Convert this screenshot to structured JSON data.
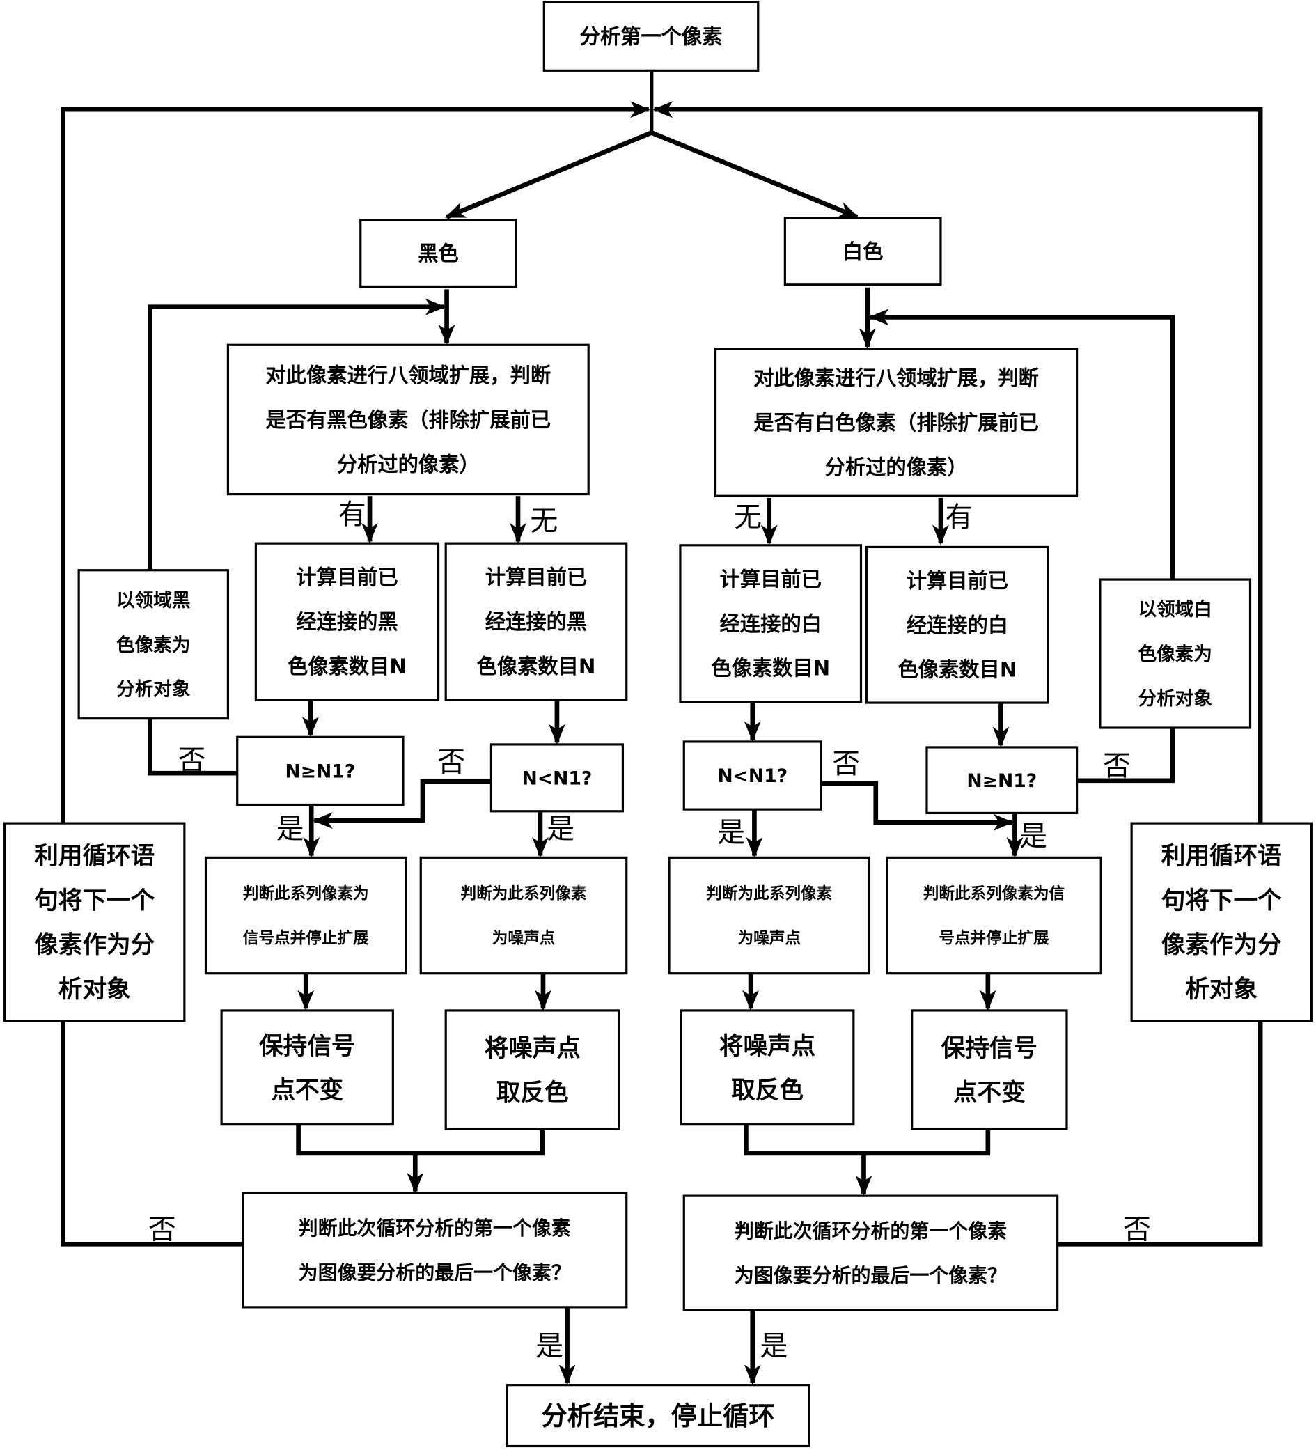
{
  "diagram": {
    "type": "flowchart",
    "nodes": {
      "start": {
        "lines": [
          "分析第一个像素"
        ]
      },
      "black": {
        "lines": [
          "黑色"
        ]
      },
      "white": {
        "lines": [
          "白色"
        ]
      },
      "expand_black": {
        "lines": [
          "对此像素进行八领域扩展，判断",
          "是否有黑色像素（排除扩展前已",
          "分析过的像素）"
        ]
      },
      "expand_white": {
        "lines": [
          "对此像素进行八领域扩展，判断",
          "是否有白色像素（排除扩展前已",
          "分析过的像素）"
        ]
      },
      "calc_black_yes": {
        "lines": [
          "计算目前已",
          "经连接的黑",
          "色像素数目N"
        ]
      },
      "calc_black_no": {
        "lines": [
          "计算目前已",
          "经连接的黑",
          "色像素数目N"
        ]
      },
      "calc_white_no": {
        "lines": [
          "计算目前已",
          "经连接的白",
          "色像素数目N"
        ]
      },
      "calc_white_yes": {
        "lines": [
          "计算目前已",
          "经连接的白",
          "色像素数目N"
        ]
      },
      "neighbor_black": {
        "lines": [
          "以领域黑",
          "色像素为",
          "分析对象"
        ]
      },
      "neighbor_white": {
        "lines": [
          "以领域白",
          "色像素为",
          "分析对象"
        ]
      },
      "dec_black_ge": {
        "lines": [
          "N≥N1?"
        ]
      },
      "dec_black_lt": {
        "lines": [
          "N<N1?"
        ]
      },
      "dec_white_lt": {
        "lines": [
          "N<N1?"
        ]
      },
      "dec_white_ge": {
        "lines": [
          "N≥N1?"
        ]
      },
      "loop_left": {
        "lines": [
          "利用循环语",
          "句将下一个",
          "像素作为分",
          "析对象"
        ]
      },
      "loop_right": {
        "lines": [
          "利用循环语",
          "句将下一个",
          "像素作为分",
          "析对象"
        ]
      },
      "judge_black_signal": {
        "lines": [
          "判断此系列像素为",
          "信号点并停止扩展"
        ]
      },
      "judge_black_noise": {
        "lines": [
          "判断为此系列像素",
          "为噪声点"
        ]
      },
      "judge_white_noise": {
        "lines": [
          "判断为此系列像素",
          "为噪声点"
        ]
      },
      "judge_white_signal": {
        "lines": [
          "判断此系列像素为信",
          "号点并停止扩展"
        ]
      },
      "keep_black": {
        "lines": [
          "保持信号",
          "点不变"
        ]
      },
      "invert_black": {
        "lines": [
          "将噪声点",
          "取反色"
        ]
      },
      "invert_white": {
        "lines": [
          "将噪声点",
          "取反色"
        ]
      },
      "keep_white": {
        "lines": [
          "保持信号",
          "点不变"
        ]
      },
      "last_black": {
        "lines": [
          "判断此次循环分析的第一个像素",
          "为图像要分析的最后一个像素？"
        ]
      },
      "last_white": {
        "lines": [
          "判断此次循环分析的第一个像素",
          "为图像要分析的最后一个像素？"
        ]
      },
      "end": {
        "lines": [
          "分析结束，停止循环"
        ]
      }
    },
    "edge_labels": {
      "has": "有",
      "none": "无",
      "no": "否",
      "yes": "是"
    }
  }
}
